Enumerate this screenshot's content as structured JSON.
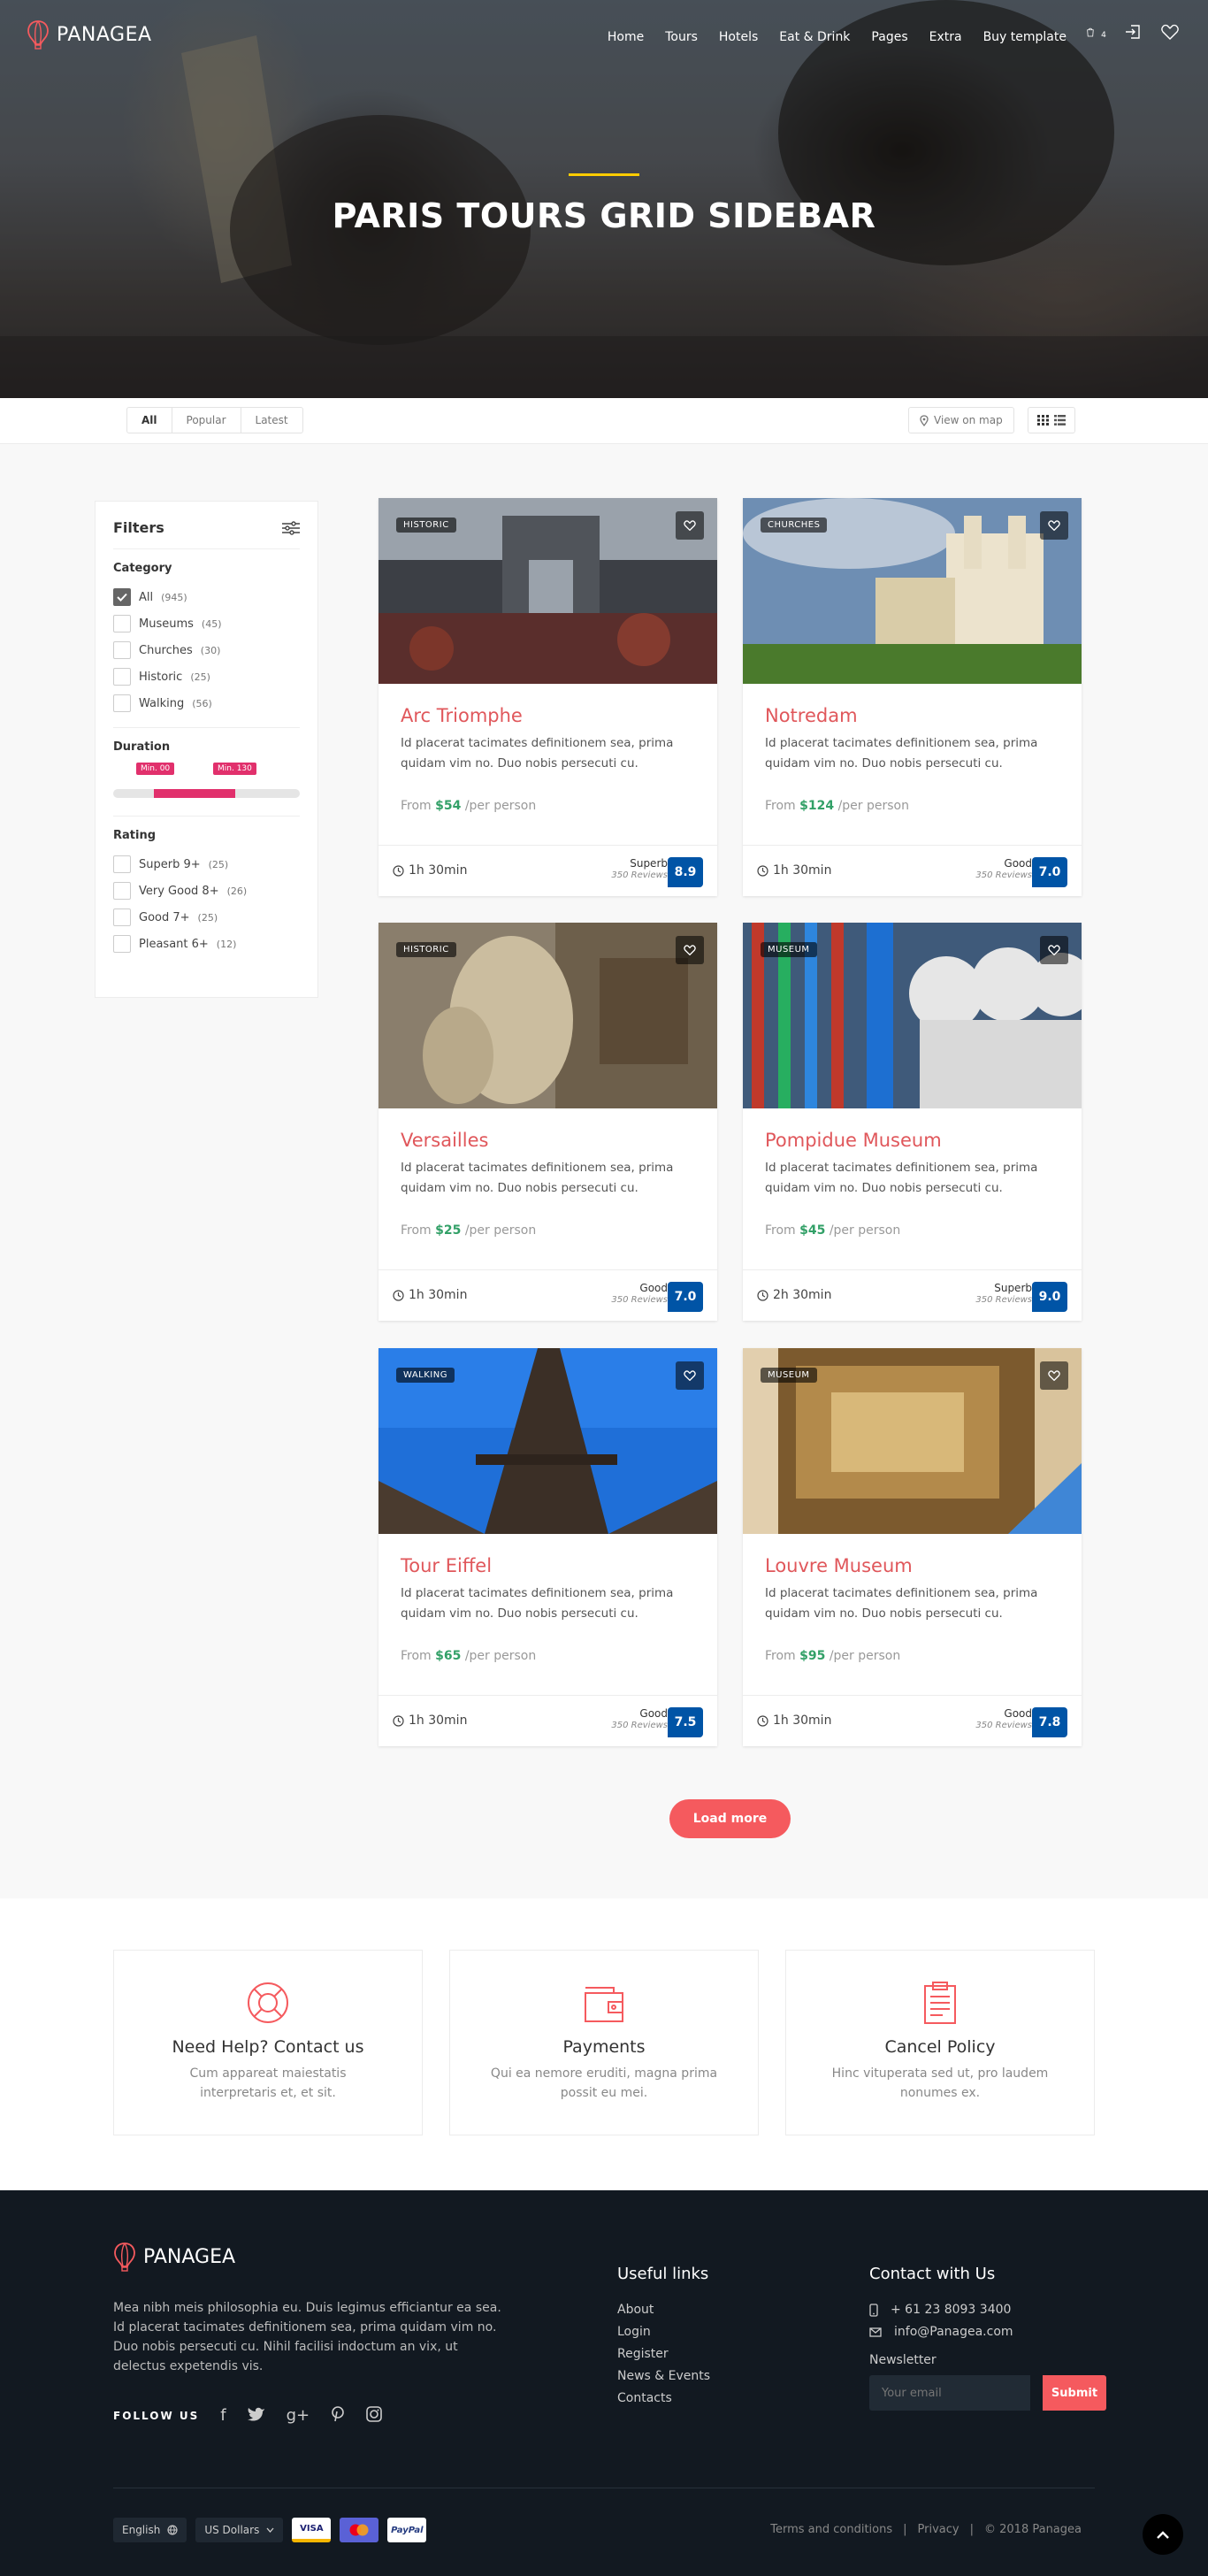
{
  "brand": {
    "name": "PANAGEA",
    "accent": "#f55a5e"
  },
  "nav": {
    "items": [
      "Home",
      "Tours",
      "Hotels",
      "Eat & Drink",
      "Pages",
      "Extra",
      "Buy template"
    ],
    "cart_count": "4",
    "icons": [
      "cart-icon",
      "login-icon",
      "heart-icon"
    ]
  },
  "hero": {
    "title": "PARIS TOURS GRID SIDEBAR"
  },
  "filter_bar": {
    "tabs": [
      "All",
      "Popular",
      "Latest"
    ],
    "active_tab": "All",
    "map_label": "View on map"
  },
  "sidebar": {
    "title": "Filters",
    "category_title": "Category",
    "categories": [
      {
        "label": "All",
        "count": "(945)",
        "checked": true
      },
      {
        "label": "Museums",
        "count": "(45)",
        "checked": false
      },
      {
        "label": "Churches",
        "count": "(30)",
        "checked": false
      },
      {
        "label": "Historic",
        "count": "(25)",
        "checked": false
      },
      {
        "label": "Walking",
        "count": "(56)",
        "checked": false
      }
    ],
    "duration_title": "Duration",
    "duration_min_label": "Min. 00",
    "duration_max_label": "Min. 130",
    "rating_title": "Rating",
    "ratings": [
      {
        "label": "Superb 9+",
        "count": "(25)"
      },
      {
        "label": "Very Good 8+",
        "count": "(26)"
      },
      {
        "label": "Good 7+",
        "count": "(25)"
      },
      {
        "label": "Pleasant 6+",
        "count": "(12)"
      }
    ]
  },
  "tours": [
    {
      "tag": "HISTORIC",
      "title": "Arc Triomphe",
      "desc": "Id placerat tacimates definitionem sea, prima quidam vim no. Duo nobis persecuti cu.",
      "price_prefix": "From",
      "price": "$54",
      "price_suffix": "/per person",
      "duration": "1h 30min",
      "rating_label": "Superb",
      "reviews": "350 Reviews",
      "score": "8.9"
    },
    {
      "tag": "CHURCHES",
      "title": "Notredam",
      "desc": "Id placerat tacimates definitionem sea, prima quidam vim no. Duo nobis persecuti cu.",
      "price_prefix": "From",
      "price": "$124",
      "price_suffix": "/per person",
      "duration": "1h 30min",
      "rating_label": "Good",
      "reviews": "350 Reviews",
      "score": "7.0"
    },
    {
      "tag": "HISTORIC",
      "title": "Versailles",
      "desc": "Id placerat tacimates definitionem sea, prima quidam vim no. Duo nobis persecuti cu.",
      "price_prefix": "From",
      "price": "$25",
      "price_suffix": "/per person",
      "duration": "1h 30min",
      "rating_label": "Good",
      "reviews": "350 Reviews",
      "score": "7.0"
    },
    {
      "tag": "MUSEUM",
      "title": "Pompidue Museum",
      "desc": "Id placerat tacimates definitionem sea, prima quidam vim no. Duo nobis persecuti cu.",
      "price_prefix": "From",
      "price": "$45",
      "price_suffix": "/per person",
      "duration": "2h 30min",
      "rating_label": "Superb",
      "reviews": "350 Reviews",
      "score": "9.0"
    },
    {
      "tag": "WALKING",
      "title": "Tour Eiffel",
      "desc": "Id placerat tacimates definitionem sea, prima quidam vim no. Duo nobis persecuti cu.",
      "price_prefix": "From",
      "price": "$65",
      "price_suffix": "/per person",
      "duration": "1h 30min",
      "rating_label": "Good",
      "reviews": "350 Reviews",
      "score": "7.5"
    },
    {
      "tag": "MUSEUM",
      "title": "Louvre Museum",
      "desc": "Id placerat tacimates definitionem sea, prima quidam vim no. Duo nobis persecuti cu.",
      "price_prefix": "From",
      "price": "$95",
      "price_suffix": "/per person",
      "duration": "1h 30min",
      "rating_label": "Good",
      "reviews": "350 Reviews",
      "score": "7.8"
    }
  ],
  "load_more": "Load more",
  "features": [
    {
      "icon": "lifebuoy-icon",
      "title": "Need Help? Contact us",
      "text": "Cum appareat maiestatis interpretaris et, et sit."
    },
    {
      "icon": "wallet-icon",
      "title": "Payments",
      "text": "Qui ea nemore eruditi, magna prima possit eu mei."
    },
    {
      "icon": "clipboard-icon",
      "title": "Cancel Policy",
      "text": "Hinc vituperata sed ut, pro laudem nonumes ex."
    }
  ],
  "footer": {
    "about": "Mea nibh meis philosophia eu. Duis legimus efficiantur ea sea. Id placerat tacimates definitionem sea, prima quidam vim no. Duo nobis persecuti cu. Nihil facilisi indoctum an vix, ut delectus expetendis vis.",
    "follow_label": "FOLLOW US",
    "social_icons": [
      "facebook-icon",
      "twitter-icon",
      "google-plus-icon",
      "pinterest-icon",
      "instagram-icon"
    ],
    "useful_title": "Useful links",
    "links": [
      "About",
      "Login",
      "Register",
      "News & Events",
      "Contacts"
    ],
    "contact_title": "Contact with Us",
    "phone": "+ 61 23 8093 3400",
    "email": "info@Panagea.com",
    "newsletter_title": "Newsletter",
    "newsletter_placeholder": "Your email",
    "submit": "Submit",
    "language": "English",
    "currency": "US Dollars",
    "payment_cards": [
      "VISA",
      "mastercard",
      "PayPal"
    ],
    "terms": "Terms and conditions",
    "privacy": "Privacy",
    "copyright": "© 2018 Panagea"
  }
}
